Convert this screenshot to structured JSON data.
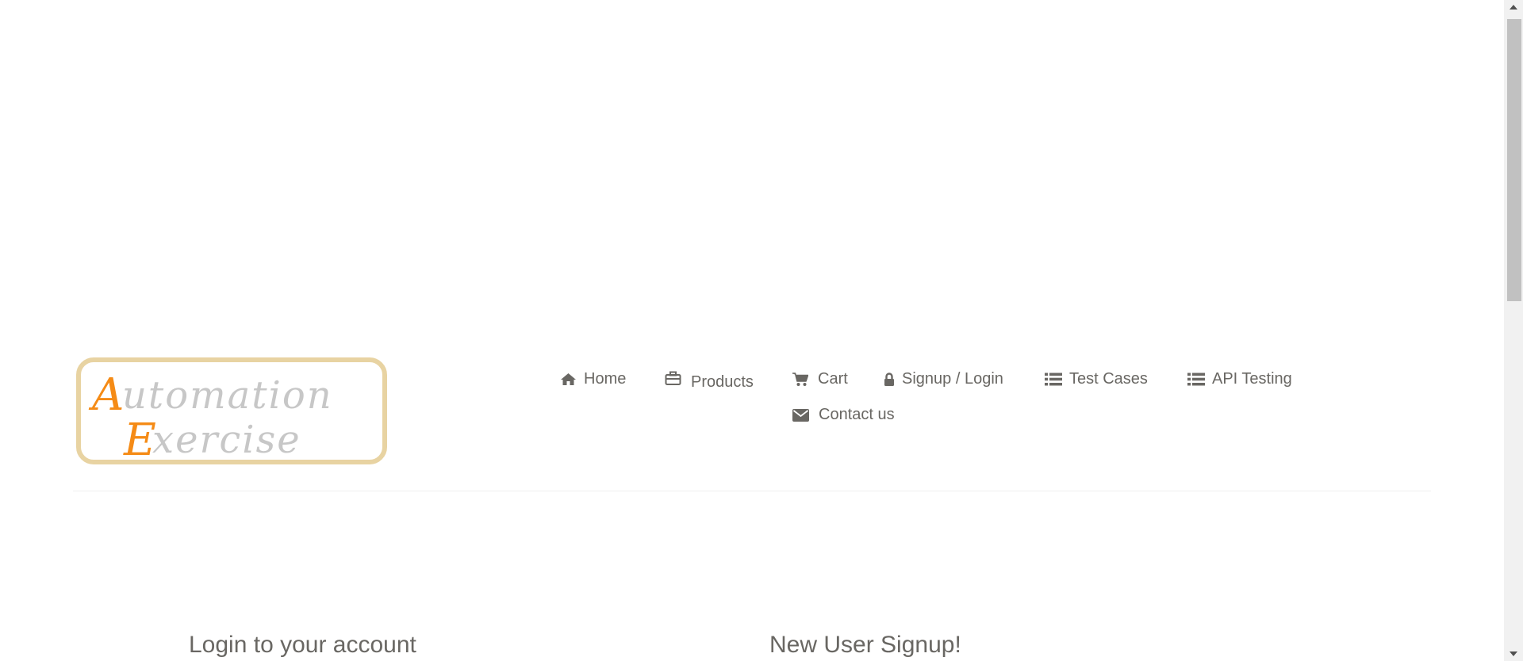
{
  "logo": {
    "text": "Automation Exercise",
    "line1": "Automation",
    "line2": "Exercise",
    "accent_color": "#f58b16",
    "text_color": "#c7c7c7",
    "border_color": "#e8d3a2"
  },
  "nav": {
    "items": [
      {
        "label": "Home",
        "icon": "home-icon"
      },
      {
        "label": "Products",
        "icon": "briefcase-icon"
      },
      {
        "label": "Cart",
        "icon": "cart-icon"
      },
      {
        "label": "Signup / Login",
        "icon": "lock-icon"
      },
      {
        "label": "Test Cases",
        "icon": "list-icon"
      },
      {
        "label": "API Testing",
        "icon": "list-icon"
      },
      {
        "label": "Contact us",
        "icon": "envelope-icon"
      }
    ],
    "text_color": "#696763"
  },
  "login": {
    "title": "Login to your account"
  },
  "signup": {
    "title": "New User Signup!"
  },
  "scrollbar": {
    "up_icon": "scroll-up-arrow-icon",
    "down_icon": "scroll-down-arrow-icon"
  }
}
